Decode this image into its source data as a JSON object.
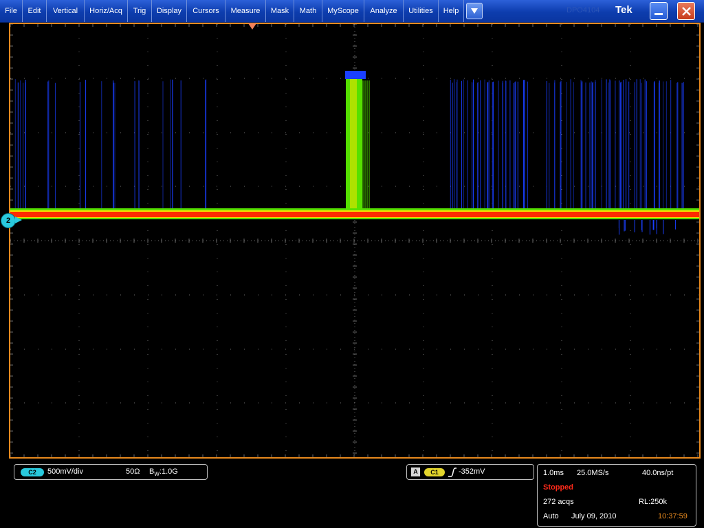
{
  "menu": {
    "items": [
      "File",
      "Edit",
      "Vertical",
      "Horiz/Acq",
      "Trig",
      "Display",
      "Cursors",
      "Measure",
      "Mask",
      "Math",
      "MyScope",
      "Analyze",
      "Utilities",
      "Help"
    ],
    "dropdown_icon": "chevron-down-icon",
    "dim_label": "DPO4104",
    "logo": "Tek",
    "minimize_icon": "minimize-icon",
    "close_icon": "close-icon"
  },
  "waveform": {
    "channel_marker": "2",
    "colors": {
      "grid": "#6b6b6b",
      "frame": "#e98a1e",
      "trace_hot": "#ff2a00",
      "trace_warm": "#f5e400",
      "trace_mid": "#55e000",
      "trace_cold": "#1a3fff"
    }
  },
  "vertical": {
    "channel": "C2",
    "scale": "500mV/div",
    "impedance": "50Ω",
    "bandwidth_prefix": "B",
    "bandwidth_sub": "W",
    "bandwidth_value": ":1.0G"
  },
  "trigger": {
    "source_box": "A",
    "source": "C1",
    "slope_icon": "rising-edge-icon",
    "level": "-352mV"
  },
  "acquisition": {
    "time_div": "1.0ms",
    "sample_rate": "25.0MS/s",
    "resolution": "40.0ns/pt",
    "state": "Stopped",
    "acqs": "272 acqs",
    "record_length": "RL:250k",
    "mode": "Auto",
    "date": "July 09, 2010",
    "time": "10:37:59"
  }
}
